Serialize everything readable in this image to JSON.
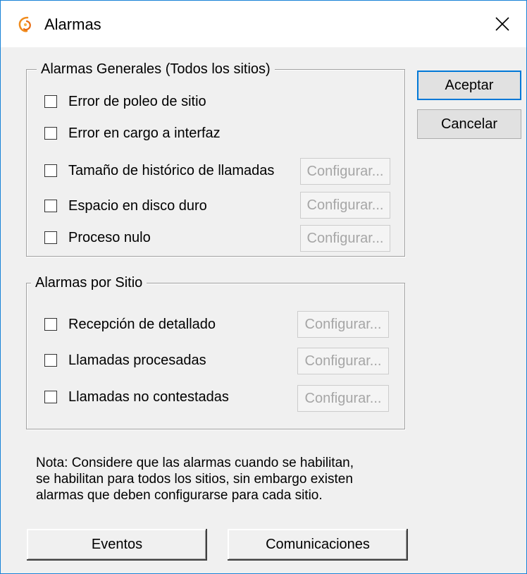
{
  "window": {
    "title": "Alarmas",
    "app_icon": "orange-swirl-icon",
    "close_icon": "close-x-icon",
    "border_color": "#1883d7"
  },
  "buttons": {
    "accept": "Aceptar",
    "cancel": "Cancelar",
    "events": "Eventos",
    "communications": "Comunicaciones"
  },
  "general_alarms": {
    "title": "Alarmas Generales (Todos los sitios)",
    "items": [
      {
        "label": "Error de poleo de sitio",
        "checked": false
      },
      {
        "label": "Error en cargo a interfaz",
        "checked": false
      },
      {
        "label": "Tamaño de histórico de llamadas",
        "checked": false,
        "configure": "Configurar..."
      },
      {
        "label": "Espacio en disco duro",
        "checked": false,
        "configure": "Configurar..."
      },
      {
        "label": "Proceso nulo",
        "checked": false,
        "configure": "Configurar..."
      }
    ]
  },
  "site_alarms": {
    "title": "Alarmas por Sitio",
    "items": [
      {
        "label": "Recepción de detallado",
        "checked": false,
        "configure": "Configurar..."
      },
      {
        "label": "Llamadas procesadas",
        "checked": false,
        "configure": "Configurar..."
      },
      {
        "label": "Llamadas no contestadas",
        "checked": false,
        "configure": "Configurar..."
      }
    ]
  },
  "note": "Nota: Considere que las alarmas cuando se habilitan, se habilitan para todos los sitios, sin embargo existen alarmas que deben configurarse para cada sitio.",
  "note_lines": [
    "Nota: Considere que las alarmas cuando se habilitan,",
    "se habilitan para todos los sitios, sin embargo existen",
    "alarmas que deben configurarse para cada sitio."
  ]
}
